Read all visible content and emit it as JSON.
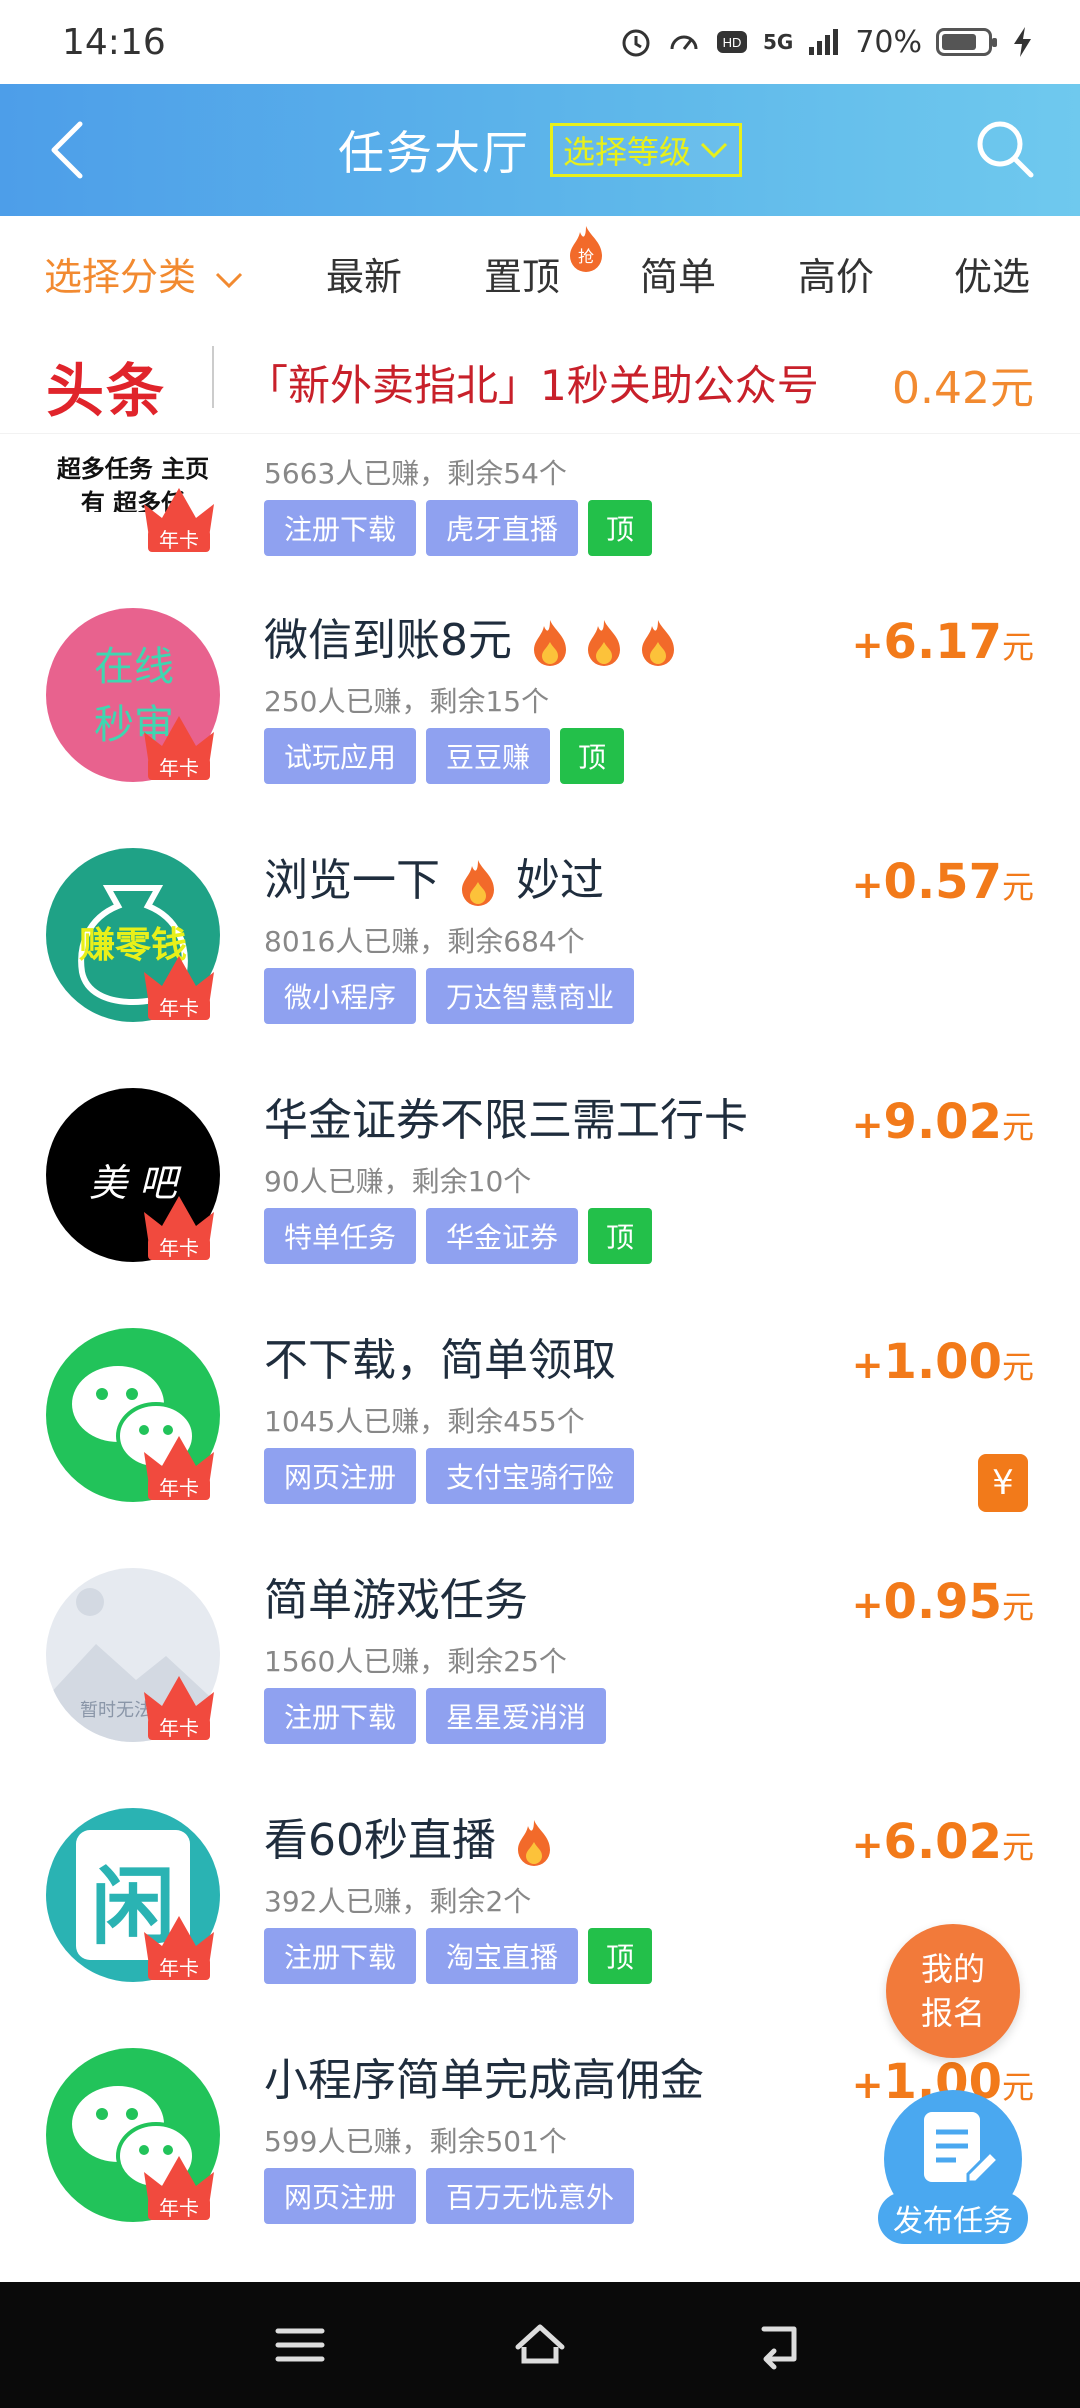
{
  "status": {
    "time": "14:16",
    "network": "5G",
    "battery": "70%"
  },
  "header": {
    "title": "任务大厅",
    "level_button": "选择等级"
  },
  "tabs": [
    {
      "label": "选择分类",
      "active": true
    },
    {
      "label": "最新"
    },
    {
      "label": "置顶",
      "badge": "抢"
    },
    {
      "label": "简单"
    },
    {
      "label": "高价"
    },
    {
      "label": "优选"
    }
  ],
  "headline": {
    "logo": "头条",
    "text": "「新外卖指北」1秒关助公众号",
    "price": "0.42元"
  },
  "partial_item": {
    "avatar_text": "超多任务 主页有 超多任",
    "stats": "5663人已赚，剩余54个",
    "tags": [
      "注册下载",
      "虎牙直播",
      "顶"
    ],
    "crown_text": "年卡"
  },
  "items": [
    {
      "title": "微信到账8元",
      "stats": "250人已赚，剩余15个",
      "tags": [
        "试玩应用",
        "豆豆赚",
        "顶"
      ],
      "price_num": "6.17",
      "avatar_text": "在线 秒审",
      "avatar_color": "#e8628e",
      "flames": 3
    },
    {
      "title_a": "浏览一下",
      "title_b": "妙过",
      "stats": "8016人已赚，剩余684个",
      "tags": [
        "微小程序",
        "万达智慧商业"
      ],
      "price_num": "0.57",
      "avatar_text": "赚零钱",
      "avatar_color": "#1fa286"
    },
    {
      "title": "华金证券不限三需工行卡",
      "stats": "90人已赚，剩余10个",
      "tags": [
        "特单任务",
        "华金证券",
        "顶"
      ],
      "price_num": "9.02",
      "avatar_text": "美 吧",
      "avatar_color": "#000000"
    },
    {
      "title": "不下载，简单领取",
      "stats": "1045人已赚，剩余455个",
      "tags": [
        "网页注册",
        "支付宝骑行险"
      ],
      "price_num": "1.00",
      "avatar_color": "#22c35a",
      "badge": "¥"
    },
    {
      "title": "简单游戏任务",
      "stats": "1560人已赚，剩余25个",
      "tags": [
        "注册下载",
        "星星爱消消"
      ],
      "price_num": "0.95",
      "avatar_text": "暂时无法",
      "avatar_color": "#e6eaf0"
    },
    {
      "title": "看60秒直播",
      "stats": "392人已赚，剩余2个",
      "tags": [
        "注册下载",
        "淘宝直播",
        "顶"
      ],
      "price_num": "6.02",
      "avatar_text": "闲",
      "avatar_color": "#2ab3b3",
      "flames": 1
    },
    {
      "title": "小程序简单完成高佣金",
      "stats": "599人已赚，剩余501个",
      "tags": [
        "网页注册",
        "百万无忧意外"
      ],
      "price_num": "1.00",
      "avatar_color": "#22c35a"
    }
  ],
  "price_prefix": "+",
  "price_unit": "元",
  "crown_label": "年卡",
  "fab": {
    "signup": [
      "我的",
      "报名"
    ],
    "publish": "发布任务"
  }
}
